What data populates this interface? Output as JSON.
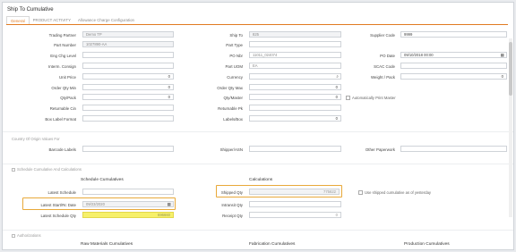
{
  "window": {
    "title": "Ship To Cumulative"
  },
  "tabs": [
    "General",
    "PRODUCT ACTIVITY",
    "Allowance Charge Configuration"
  ],
  "fields": {
    "trading_partner": {
      "label": "Trading Partner",
      "value": "Demo TP"
    },
    "ship_to": {
      "label": "Ship To",
      "value": "825"
    },
    "supplier_code": {
      "label": "Supplier Code",
      "value": "9999"
    },
    "part_number": {
      "label": "Part Number",
      "value": "1027890-AA"
    },
    "part_type": {
      "label": "Part Type",
      "value": ""
    },
    "eng_chg_level": {
      "label": "Eng Chg Level",
      "value": ""
    },
    "po_nbr": {
      "label": "PO Nbr",
      "value": "11011_024074"
    },
    "po_date": {
      "label": "PO Date",
      "value": "09/10/2018 00:00"
    },
    "interm_consign": {
      "label": "Interm. Consign",
      "value": ""
    },
    "part_uom": {
      "label": "Part UOM",
      "value": "EA"
    },
    "scac_code": {
      "label": "SCAC Code",
      "value": ""
    },
    "unit_price": {
      "label": "Unit Price",
      "value": "0"
    },
    "currency": {
      "label": "Currency",
      "value": ""
    },
    "weight_pack": {
      "label": "Weight / Pack",
      "value": "0"
    },
    "order_qty_min": {
      "label": "Order Qty Min",
      "value": "0"
    },
    "order_qty_max": {
      "label": "Order Qty Max",
      "value": "0"
    },
    "qty_pack": {
      "label": "Qty/Pack",
      "value": "0"
    },
    "qty_master": {
      "label": "Qty/Master",
      "value": "0"
    },
    "returnable_cin": {
      "label": "Returnable Cin",
      "value": ""
    },
    "returnable_pk": {
      "label": "Returnable Pk",
      "value": ""
    },
    "box_label_format": {
      "label": "Box Label Format",
      "value": ""
    },
    "labels_box": {
      "label": "Labels/Box",
      "value": "0"
    },
    "auto_print_master": {
      "label": "Automatically Print Master",
      "checked": false
    }
  },
  "country_section": {
    "title": "Country Of Origin Values For",
    "barcode_labels": {
      "label": "Barcode Labels",
      "value": ""
    },
    "shipper_asn": {
      "label": "Shipper/ASN",
      "value": ""
    },
    "other_paperwork": {
      "label": "Other Paperwork",
      "value": ""
    }
  },
  "schedule_section": {
    "title": "Schedule Cumulative And Calculations",
    "col_schedule": "Schedule Cumulatives",
    "col_calc": "Calculations",
    "latest_schedule": {
      "label": "Latest Schedule",
      "value": ""
    },
    "shipped_qty": {
      "label": "Shipped Qty",
      "value": "775622"
    },
    "use_shipped": {
      "label": "Use shipped cumulative as of yesterday",
      "checked": false
    },
    "latest_start_rec_date": {
      "label": "Latest Start/Rc Date",
      "value": "09/23/2020"
    },
    "intransit_qty": {
      "label": "Intransit Qty",
      "value": ""
    },
    "latest_schedule_qty": {
      "label": "Latest Schedule Qty",
      "value": "696660"
    },
    "receipt_qty": {
      "label": "Receipt Qty",
      "value": "0"
    }
  },
  "authorizations": {
    "title": "Authorizations",
    "col_raw": "Raw Materials Cumulatives",
    "col_fab": "Fabrication Cumulatives",
    "col_prod": "Production Cumulatives"
  },
  "icons": {
    "search": "search-icon",
    "calendar": "calendar-icon"
  },
  "colors": {
    "accent": "#e07b22",
    "highlight": "#e8a93a",
    "yellow_field": "#f6f06a"
  }
}
